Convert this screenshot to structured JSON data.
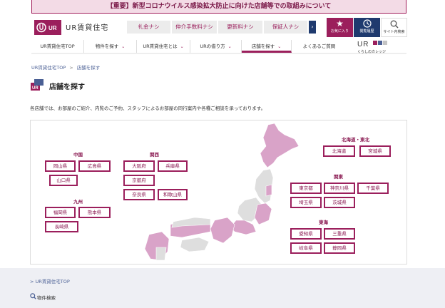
{
  "notice": {
    "text": "【重要】新型コロナウイルス感染拡大防止に向けた店舗等での取組みについて"
  },
  "header": {
    "logo_mark": "UR",
    "logo_name": "UR賃貸住宅",
    "tags": [
      "礼金ナシ",
      "仲介手数料ナシ",
      "更新料ナシ",
      "保証人ナシ"
    ],
    "tag_arrow": "›",
    "buttons": [
      {
        "label": "お気に入り",
        "icon": "star-icon"
      },
      {
        "label": "閲覧履歴",
        "icon": "clock-icon"
      },
      {
        "label": "サイト内検索",
        "icon": "search-icon"
      }
    ]
  },
  "nav": {
    "items": [
      {
        "label": "UR賃貸住宅TOP",
        "chevron": false
      },
      {
        "label": "物件を探す",
        "chevron": true
      },
      {
        "label": "UR賃貸住宅とは",
        "chevron": true
      },
      {
        "label": "URの借り方",
        "chevron": true
      },
      {
        "label": "店舗を探す",
        "chevron": true,
        "active": true
      },
      {
        "label": "よくあるご質問",
        "chevron": false
      }
    ],
    "brand_top": "UR",
    "brand_bottom": "くらしのカレッジ"
  },
  "breadcrumb": {
    "home": "UR賃貸住宅TOP",
    "sep": ">",
    "current": "店舗を探す"
  },
  "page": {
    "title": "店舗を探す",
    "description": "各店舗では、お部屋のご紹介、内覧のご予約、スタッフによるお部屋の同行案内や各種ご相談を承っております。"
  },
  "map": {
    "colors": {
      "highlight": "#d9a3c8",
      "base": "#dedede",
      "accent": "#9b1f5c"
    },
    "regions": {
      "chugoku": {
        "title": "中国",
        "prefs": [
          "岡山県",
          "広島県",
          "山口県"
        ]
      },
      "kyushu": {
        "title": "九州",
        "prefs": [
          "福岡県",
          "熊本県",
          "長崎県"
        ]
      },
      "kansai": {
        "title": "関西",
        "prefs": [
          "大阪府",
          "兵庫県",
          "京都府",
          "奈良県",
          "和歌山県"
        ]
      },
      "hokkaido_tohoku": {
        "title": "北海道・東北",
        "prefs": [
          "北海道",
          "宮城県"
        ]
      },
      "kanto": {
        "title": "関東",
        "prefs": [
          "東京都",
          "神奈川県",
          "千葉県",
          "埼玉県",
          "茨城県"
        ]
      },
      "tokai": {
        "title": "東海",
        "prefs": [
          "愛知県",
          "三重県",
          "岐阜県",
          "静岡県"
        ]
      }
    }
  },
  "footer": {
    "top_link": "> UR賃貸住宅TOP",
    "search_label": "物件検索"
  }
}
